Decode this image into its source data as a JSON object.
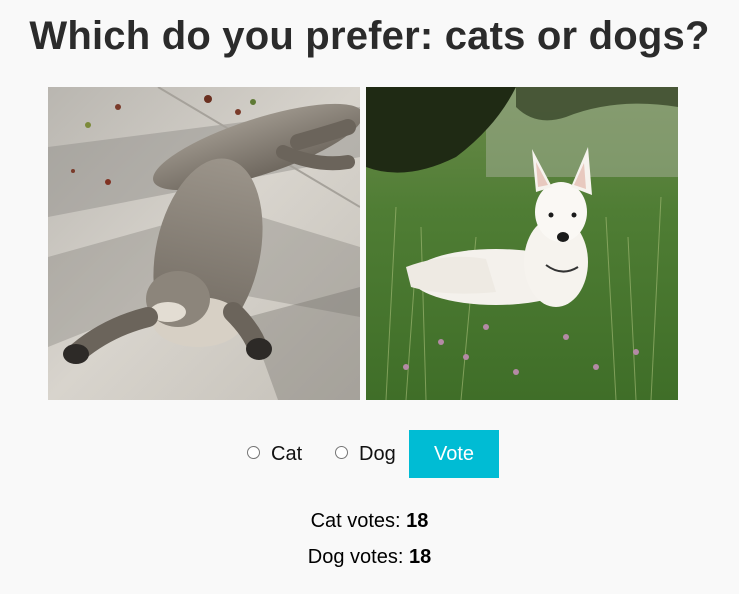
{
  "title": "Which do you prefer: cats or dogs?",
  "photos": [
    {
      "subject": "cat",
      "icon": "cat-photo"
    },
    {
      "subject": "dog",
      "icon": "dog-photo"
    }
  ],
  "options": [
    {
      "label": "Cat",
      "checked": false
    },
    {
      "label": "Dog",
      "checked": false
    }
  ],
  "vote_button": {
    "label": "Vote",
    "color": "#00bcd4"
  },
  "results": {
    "cat_label": "Cat votes:",
    "cat_count": "18",
    "dog_label": "Dog votes:",
    "dog_count": "18"
  }
}
